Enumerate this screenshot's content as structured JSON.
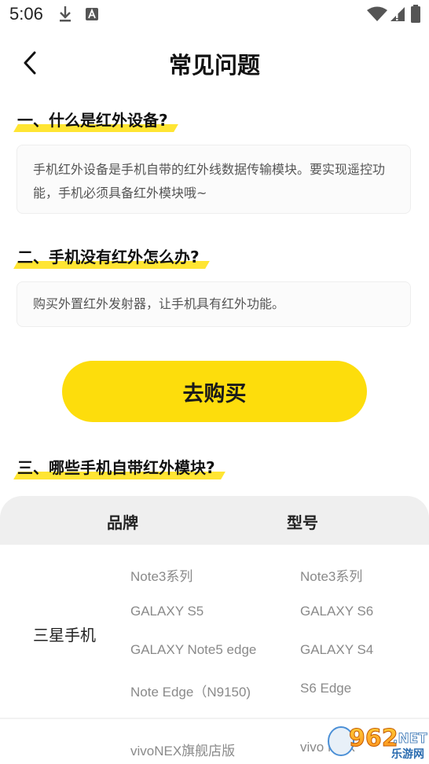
{
  "status_bar": {
    "time": "5:06"
  },
  "header": {
    "title": "常见问题"
  },
  "faq": [
    {
      "question": "一、什么是红外设备?",
      "answer": "手机红外设备是手机自带的红外线数据传输模块。要实现遥控功能，手机必须具备红外模块哦~"
    },
    {
      "question": "二、手机没有红外怎么办?",
      "answer": "购买外置红外发射器，让手机具有红外功能。"
    }
  ],
  "buy_button": {
    "label": "去购买"
  },
  "section3": {
    "title": "三、哪些手机自带红外模块?"
  },
  "table": {
    "headers": {
      "brand": "品牌",
      "model": "型号"
    },
    "rows": [
      {
        "brand": "三星手机",
        "models_left": [
          "Note3系列",
          "GALAXY S5",
          "GALAXY Note5 edge",
          "Note Edge（N9150)"
        ],
        "models_right": [
          "Note3系列",
          "GALAXY S6",
          "GALAXY S4",
          "S6 Edge"
        ]
      },
      {
        "brand": "",
        "models_left": [
          "vivoNEX旗舰店版"
        ],
        "models_right": [
          "vivo NEX"
        ]
      }
    ]
  },
  "watermark": {
    "text_number": "962",
    "text_net": ".NET",
    "text_sub": "乐游网"
  },
  "colors": {
    "accent_yellow": "#fddd0c",
    "highlight_yellow": "#ffe533",
    "table_header_bg": "#efefef"
  }
}
